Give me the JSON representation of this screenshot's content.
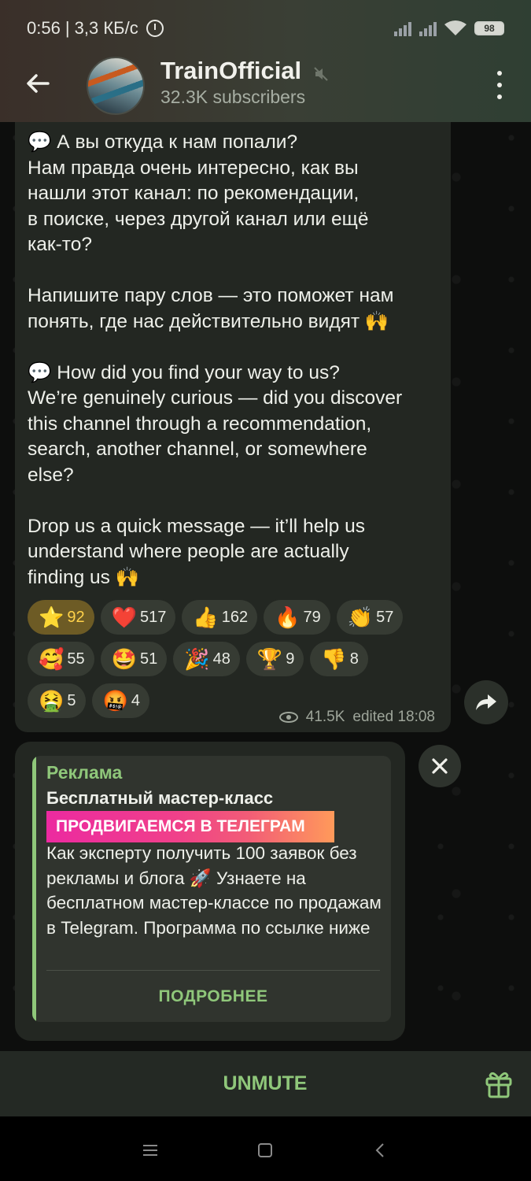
{
  "status_bar": {
    "time": "0:56",
    "speed": "| 3,3 КБ/с",
    "battery": "98"
  },
  "header": {
    "title": "TrainOfficial",
    "subtitle": "32.3K subscribers"
  },
  "message": {
    "text": "💬 А вы откуда к нам попали?\nНам правда очень интересно, как вы\nнашли этот канал: по рекомендации,\nв поиске, через другой канал или ещё\nкак-то?\n\nНапишите пару слов — это поможет нам\nпонять, где нас действительно видят 🙌\n\n💬 How did you find your way to us?\nWe’re genuinely curious — did you discover\nthis channel through a recommendation,\nsearch, another channel, or somewhere\nelse?\n\nDrop us a quick message — it’ll help us\nunderstand where people are actually\nfinding us 🙌",
    "reactions": [
      [
        {
          "emoji": "⭐",
          "count": "92"
        },
        {
          "emoji": "❤️",
          "count": "517"
        },
        {
          "emoji": "👍",
          "count": "162"
        },
        {
          "emoji": "🔥",
          "count": "79"
        },
        {
          "emoji": "👏",
          "count": "57"
        }
      ],
      [
        {
          "emoji": "🥰",
          "count": "55"
        },
        {
          "emoji": "🤩",
          "count": "51"
        },
        {
          "emoji": "🎉",
          "count": "48"
        },
        {
          "emoji": "🏆",
          "count": "9"
        },
        {
          "emoji": "👎",
          "count": "8"
        }
      ],
      [
        {
          "emoji": "🤮",
          "count": "5"
        },
        {
          "emoji": "🤬",
          "count": "4"
        }
      ]
    ],
    "views": "41.5K",
    "edited": "edited 18:08"
  },
  "sponsored": {
    "label": "Реклама",
    "title": "Бесплатный мастер-класс",
    "banner": "ПРОДВИГАЕМСЯ В ТЕЛЕГРАМ",
    "body": "Как эксперту получить 100 заявок без рекламы и блога 🚀 Узнаете на бесплатном мастер-классе по продажам в Telegram. Программа по ссылке ниже",
    "button": "ПОДРОБНЕЕ"
  },
  "bottom_bar": {
    "unmute": "UNMUTE"
  },
  "colors": {
    "accent": "#8fc77a",
    "bubble": "#232722",
    "active_reaction": "#6d5b25"
  },
  "icons": [
    "back-arrow-icon",
    "mute-icon",
    "menu-icon",
    "eye-icon",
    "share-icon",
    "close-icon",
    "gift-icon",
    "alarm-icon",
    "signal-icon",
    "wifi-icon",
    "battery-icon"
  ]
}
